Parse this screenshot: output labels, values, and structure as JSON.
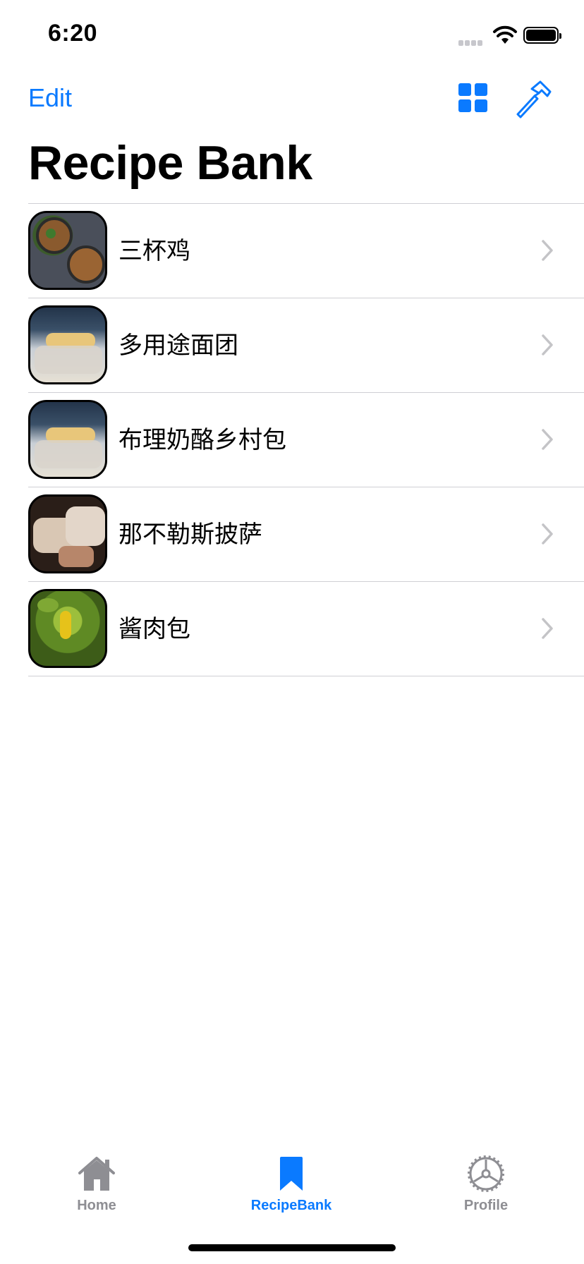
{
  "status_bar": {
    "time": "6:20"
  },
  "nav_bar": {
    "edit_label": "Edit",
    "grid_icon": "grid-icon",
    "hammer_icon": "hammer-icon"
  },
  "page_title": "Recipe Bank",
  "recipes": [
    {
      "name": "三杯鸡",
      "thumbnail": "dish-bowls"
    },
    {
      "name": "多用途面团",
      "thumbnail": "dough-rolling"
    },
    {
      "name": "布理奶酪乡村包",
      "thumbnail": "dough-rolling"
    },
    {
      "name": "那不勒斯披萨",
      "thumbnail": "bread-pieces"
    },
    {
      "name": "酱肉包",
      "thumbnail": "green-leaves"
    }
  ],
  "tab_bar": {
    "tabs": [
      {
        "label": "Home",
        "icon": "home-icon",
        "selected": false
      },
      {
        "label": "RecipeBank",
        "icon": "bookmark-icon",
        "selected": true
      },
      {
        "label": "Profile",
        "icon": "gear-icon",
        "selected": false
      }
    ]
  },
  "colors": {
    "accent": "#0a7aff",
    "inactive_tab": "#8e8e93",
    "separator": "#cfcfd4",
    "chevron": "#c4c4c7"
  }
}
